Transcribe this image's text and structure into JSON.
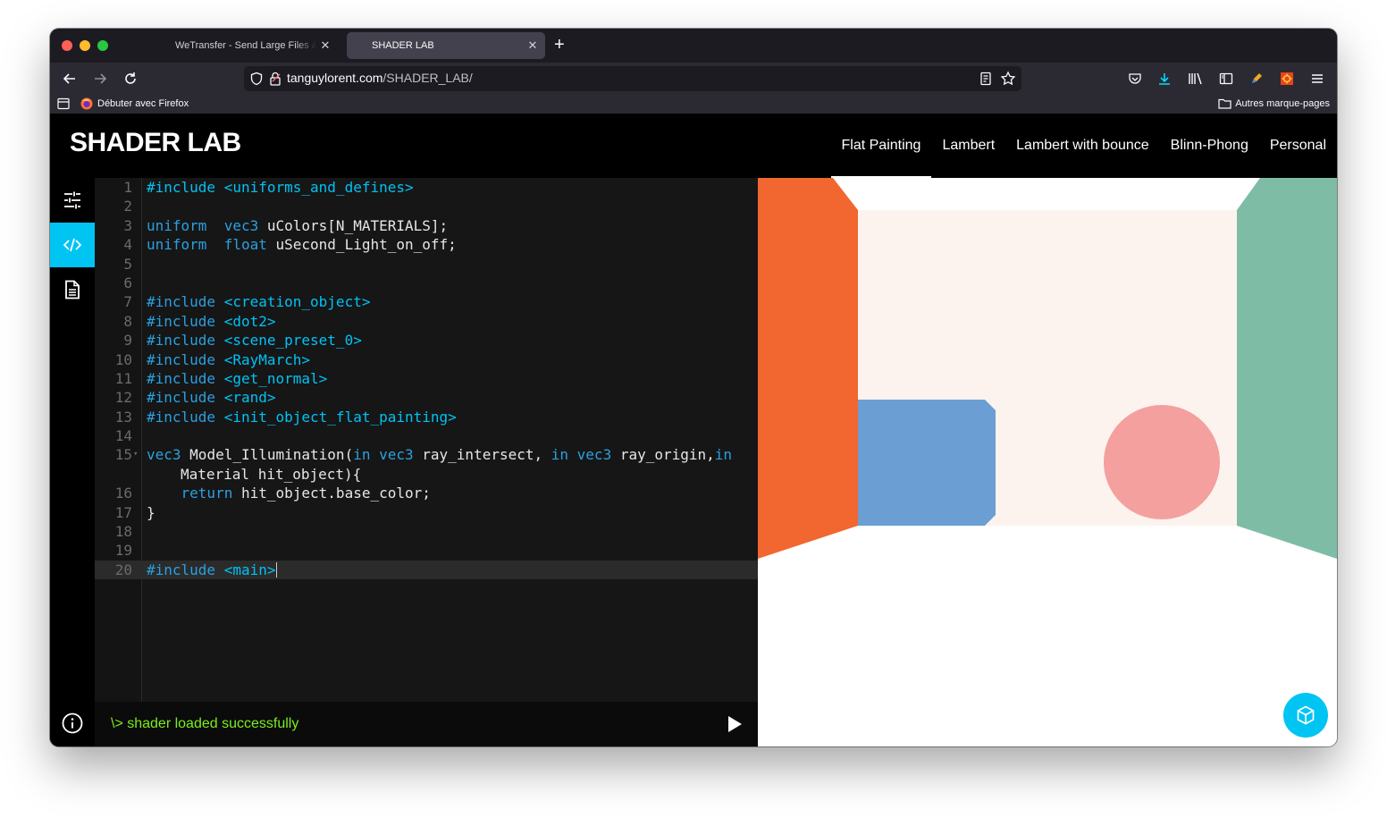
{
  "browser": {
    "tabs": [
      {
        "label": "WeTransfer - Send Large Files & Share",
        "active": false
      },
      {
        "label": "SHADER LAB",
        "active": true
      }
    ],
    "url_host": "tanguylorent.com",
    "url_path": "/SHADER_LAB/",
    "bookmarks_left": "Débuter avec Firefox",
    "bookmarks_right": "Autres marque-pages"
  },
  "site": {
    "logo": "SHADER LAB",
    "menu": [
      "Flat Painting",
      "Lambert",
      "Lambert with bounce",
      "Blinn-Phong",
      "Personal"
    ],
    "active_menu": "Flat Painting"
  },
  "editor": {
    "lines": [
      {
        "n": "1",
        "segs": [
          [
            "inc",
            "#include "
          ],
          [
            "inc",
            "<uniforms_and_defines>"
          ]
        ]
      },
      {
        "n": "2",
        "segs": []
      },
      {
        "n": "3",
        "segs": [
          [
            "kw",
            "uniform  vec3 "
          ],
          [
            "",
            "uColors[N_MATERIALS];"
          ]
        ]
      },
      {
        "n": "4",
        "segs": [
          [
            "kw",
            "uniform  float "
          ],
          [
            "",
            "uSecond_Light_on_off;"
          ]
        ]
      },
      {
        "n": "5",
        "segs": []
      },
      {
        "n": "6",
        "segs": []
      },
      {
        "n": "7",
        "segs": [
          [
            "kw",
            "#include "
          ],
          [
            "inc",
            "<creation_object>"
          ]
        ]
      },
      {
        "n": "8",
        "segs": [
          [
            "kw",
            "#include "
          ],
          [
            "inc",
            "<dot2>"
          ]
        ]
      },
      {
        "n": "9",
        "segs": [
          [
            "kw",
            "#include "
          ],
          [
            "inc",
            "<scene_preset_0>"
          ]
        ]
      },
      {
        "n": "10",
        "segs": [
          [
            "kw",
            "#include "
          ],
          [
            "inc",
            "<RayMarch>"
          ]
        ]
      },
      {
        "n": "11",
        "segs": [
          [
            "kw",
            "#include "
          ],
          [
            "inc",
            "<get_normal>"
          ]
        ]
      },
      {
        "n": "12",
        "segs": [
          [
            "kw",
            "#include "
          ],
          [
            "inc",
            "<rand>"
          ]
        ]
      },
      {
        "n": "13",
        "segs": [
          [
            "kw",
            "#include "
          ],
          [
            "inc",
            "<init_object_flat_painting>"
          ]
        ]
      },
      {
        "n": "14",
        "segs": []
      },
      {
        "n": "15",
        "fold": true,
        "segs": [
          [
            "kw",
            "vec3 "
          ],
          [
            "",
            "Model_Illumination("
          ],
          [
            "kw",
            "in vec3 "
          ],
          [
            "",
            "ray_intersect, "
          ],
          [
            "kw",
            "in vec3 "
          ],
          [
            "",
            "ray_origin,"
          ],
          [
            "kw",
            "in"
          ]
        ],
        "wrap": "Material hit_object){"
      },
      {
        "n": "16",
        "segs": [
          [
            "",
            "    "
          ],
          [
            "kw",
            "return "
          ],
          [
            "",
            "hit_object.base_color;"
          ]
        ]
      },
      {
        "n": "17",
        "segs": [
          [
            "",
            "}"
          ]
        ]
      },
      {
        "n": "18",
        "segs": []
      },
      {
        "n": "19",
        "segs": []
      },
      {
        "n": "20",
        "current": true,
        "segs": [
          [
            "kw",
            "#include "
          ],
          [
            "inc",
            "<main>"
          ]
        ]
      }
    ]
  },
  "console": {
    "message": "\\> shader loaded successfully"
  },
  "scene_colors": {
    "left_wall": "#f26630",
    "right_wall": "#7ebca6",
    "back_wall": "#fcf3ee",
    "box": "#6b9fd4",
    "sphere": "#f4a09f",
    "accent": "#00c4f2",
    "console_text": "#7bed1d"
  },
  "icons": {
    "sidebar": [
      "sliders-icon",
      "code-icon",
      "document-icon"
    ],
    "info": "info-icon",
    "fab": "cube-icon",
    "run": "play-icon"
  }
}
